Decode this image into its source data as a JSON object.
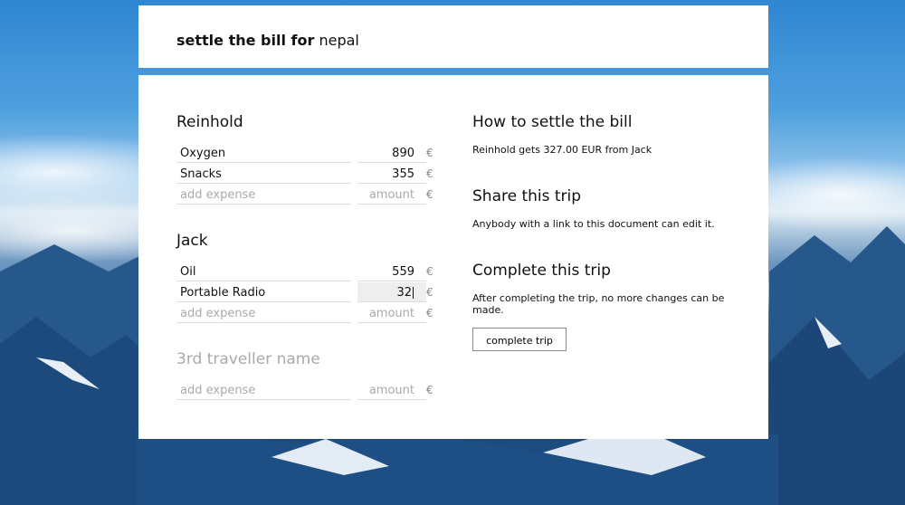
{
  "header": {
    "prefix": "settle the bill for",
    "trip_name": "nepal"
  },
  "travellers": [
    {
      "name": "Reinhold",
      "expenses": [
        {
          "name": "Oxygen",
          "amount": "890"
        },
        {
          "name": "Snacks",
          "amount": "355"
        }
      ]
    },
    {
      "name": "Jack",
      "expenses": [
        {
          "name": "Oil",
          "amount": "559"
        },
        {
          "name": "Portable Radio",
          "amount": "32"
        }
      ]
    }
  ],
  "new_traveller": {
    "placeholder": "3rd traveller name"
  },
  "placeholders": {
    "expense": "add expense",
    "amount": "amount"
  },
  "currency_symbol": "€",
  "settle": {
    "title": "How to settle the bill",
    "result": "Reinhold gets 327.00 EUR from Jack"
  },
  "share": {
    "title": "Share this trip",
    "text": "Anybody with a link to this document can edit it."
  },
  "complete": {
    "title": "Complete this trip",
    "text": "After completing the trip, no more changes can be made.",
    "button_label": "complete trip"
  }
}
